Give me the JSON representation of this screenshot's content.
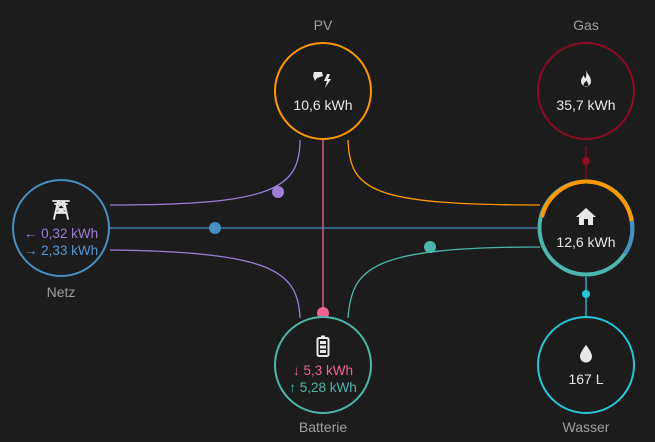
{
  "pv": {
    "label": "PV",
    "value": "10,6 kWh",
    "icon": "solar-power-icon",
    "color": "#ff9800"
  },
  "gas": {
    "label": "Gas",
    "value": "35,7 kWh",
    "icon": "fire-icon",
    "color": "#8e0b21"
  },
  "grid": {
    "label": "Netz",
    "import": "← 0,32 kWh",
    "export": "→ 2,33 kWh",
    "icon": "transmission-tower-icon",
    "color": "#488fc2",
    "import_color": "#9d7ed9"
  },
  "home": {
    "value": "12,6 kWh",
    "icon": "home-icon",
    "color": "#ff9800",
    "accent_grid": "#488fc2",
    "accent_battery": "#4db6ac"
  },
  "battery": {
    "label": "Batterie",
    "in": "↓ 5,3 kWh",
    "out": "↑ 5,28 kWh",
    "icon": "battery-icon",
    "color": "#4db6ac",
    "in_color": "#f06292"
  },
  "water": {
    "label": "Wasser",
    "value": "167 L",
    "icon": "water-drop-icon",
    "color": "#26c6da"
  }
}
